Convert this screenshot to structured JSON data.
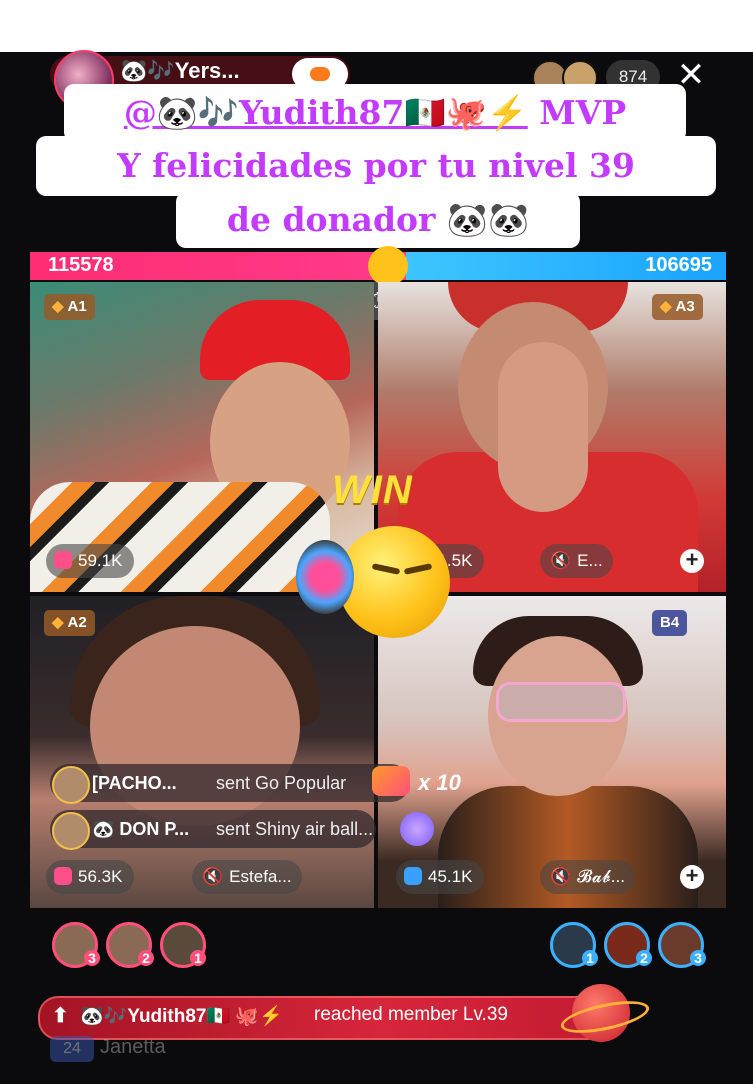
{
  "header": {
    "host_name": "🐼🎶Yers...",
    "viewer_count": "874",
    "close_glyph": "✕"
  },
  "banner": {
    "line1_mention": "@🐼🎶Yudith87🇲🇽🐙⚡",
    "line1_suffix": "MVP",
    "line2": "Y felicidades por tu nivel 39",
    "line3": "de donador 🐼🐼"
  },
  "battle": {
    "score_left": "115578",
    "score_right": "106695",
    "timer_icon": "⏱",
    "win_label": "WIN"
  },
  "tiles": [
    {
      "rank": "A1",
      "count": "59.1K"
    },
    {
      "rank": "A3",
      "count": "61.5K",
      "guest_label": "E..."
    },
    {
      "rank": "A2",
      "count": "56.3K",
      "guest_label": "Estefa..."
    },
    {
      "rank": "B4",
      "count": "45.1K",
      "guest_label": "𝓑𝓪𝓫..."
    }
  ],
  "gifts": [
    {
      "name": "[PACHO...",
      "message": "sent Go Popular"
    },
    {
      "name": "🐼 DON P...",
      "message": "sent Shiny air ball..."
    }
  ],
  "gift_multiplier": "x 10",
  "rankings": {
    "left": [
      "3",
      "2",
      "1"
    ],
    "right": [
      "1",
      "2",
      "3"
    ]
  },
  "member_notice": {
    "arrow": "⬆",
    "user": "🐼🎶Yudith87🇲🇽 🐙⚡",
    "text": "reached member Lv.39"
  },
  "chat_preview": {
    "badge": "24",
    "text": "Janetta"
  },
  "colors": {
    "banner_text": "#c23bff",
    "score_left": "#ff2d73",
    "score_right": "#1aa3ff",
    "member_bar": "#d7263b"
  },
  "icons": [
    "panda-icon",
    "timer-icon",
    "gift-icon",
    "mute-icon",
    "plus-icon",
    "close-icon",
    "gem-icon"
  ]
}
